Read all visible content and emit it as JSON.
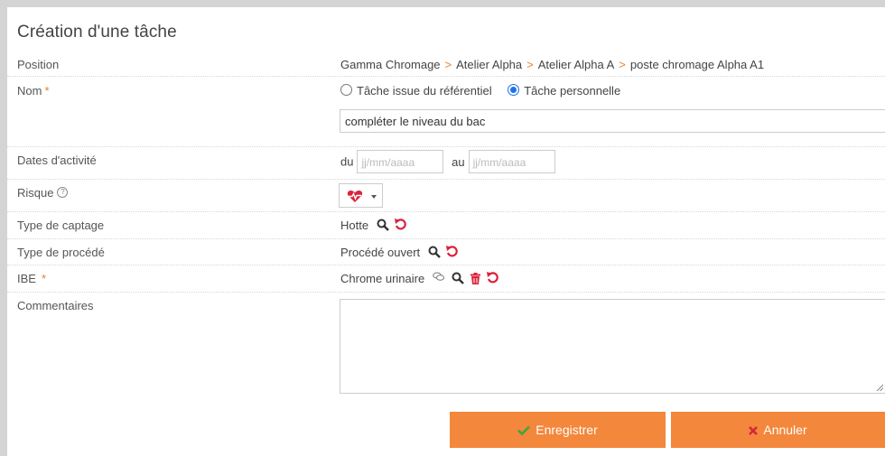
{
  "form": {
    "title": "Création d'une tâche",
    "position": {
      "label": "Position",
      "path": [
        "Gamma Chromage",
        "Atelier Alpha",
        "Atelier Alpha A",
        "poste chromage Alpha A1"
      ],
      "separator": ">"
    },
    "nom": {
      "label": "Nom",
      "required_mark": "*",
      "radio_options": [
        {
          "label": "Tâche issue du référentiel",
          "selected": false
        },
        {
          "label": "Tâche personnelle",
          "selected": true
        }
      ],
      "value": "compléter le niveau du bac"
    },
    "dates": {
      "label": "Dates d'activité",
      "from_label": "du",
      "to_label": "au",
      "from_placeholder": "jj/mm/aaaa",
      "to_placeholder": "jj/mm/aaaa"
    },
    "risque": {
      "label": "Risque",
      "help_icon": "?",
      "selected_icon": "heart-pulse-icon"
    },
    "captage": {
      "label": "Type de captage",
      "value": "Hotte"
    },
    "procede": {
      "label": "Type de procédé",
      "value": "Procédé ouvert"
    },
    "ibe": {
      "label": "IBE",
      "required_mark": "*",
      "value": "Chrome urinaire"
    },
    "commentaires": {
      "label": "Commentaires",
      "value": ""
    }
  },
  "actions": {
    "save_label": "Enregistrer",
    "cancel_label": "Annuler"
  },
  "colors": {
    "accent": "#f3873c",
    "required": "#e8802e",
    "icon_red": "#d9243c",
    "radio_blue": "#1e73e8"
  }
}
